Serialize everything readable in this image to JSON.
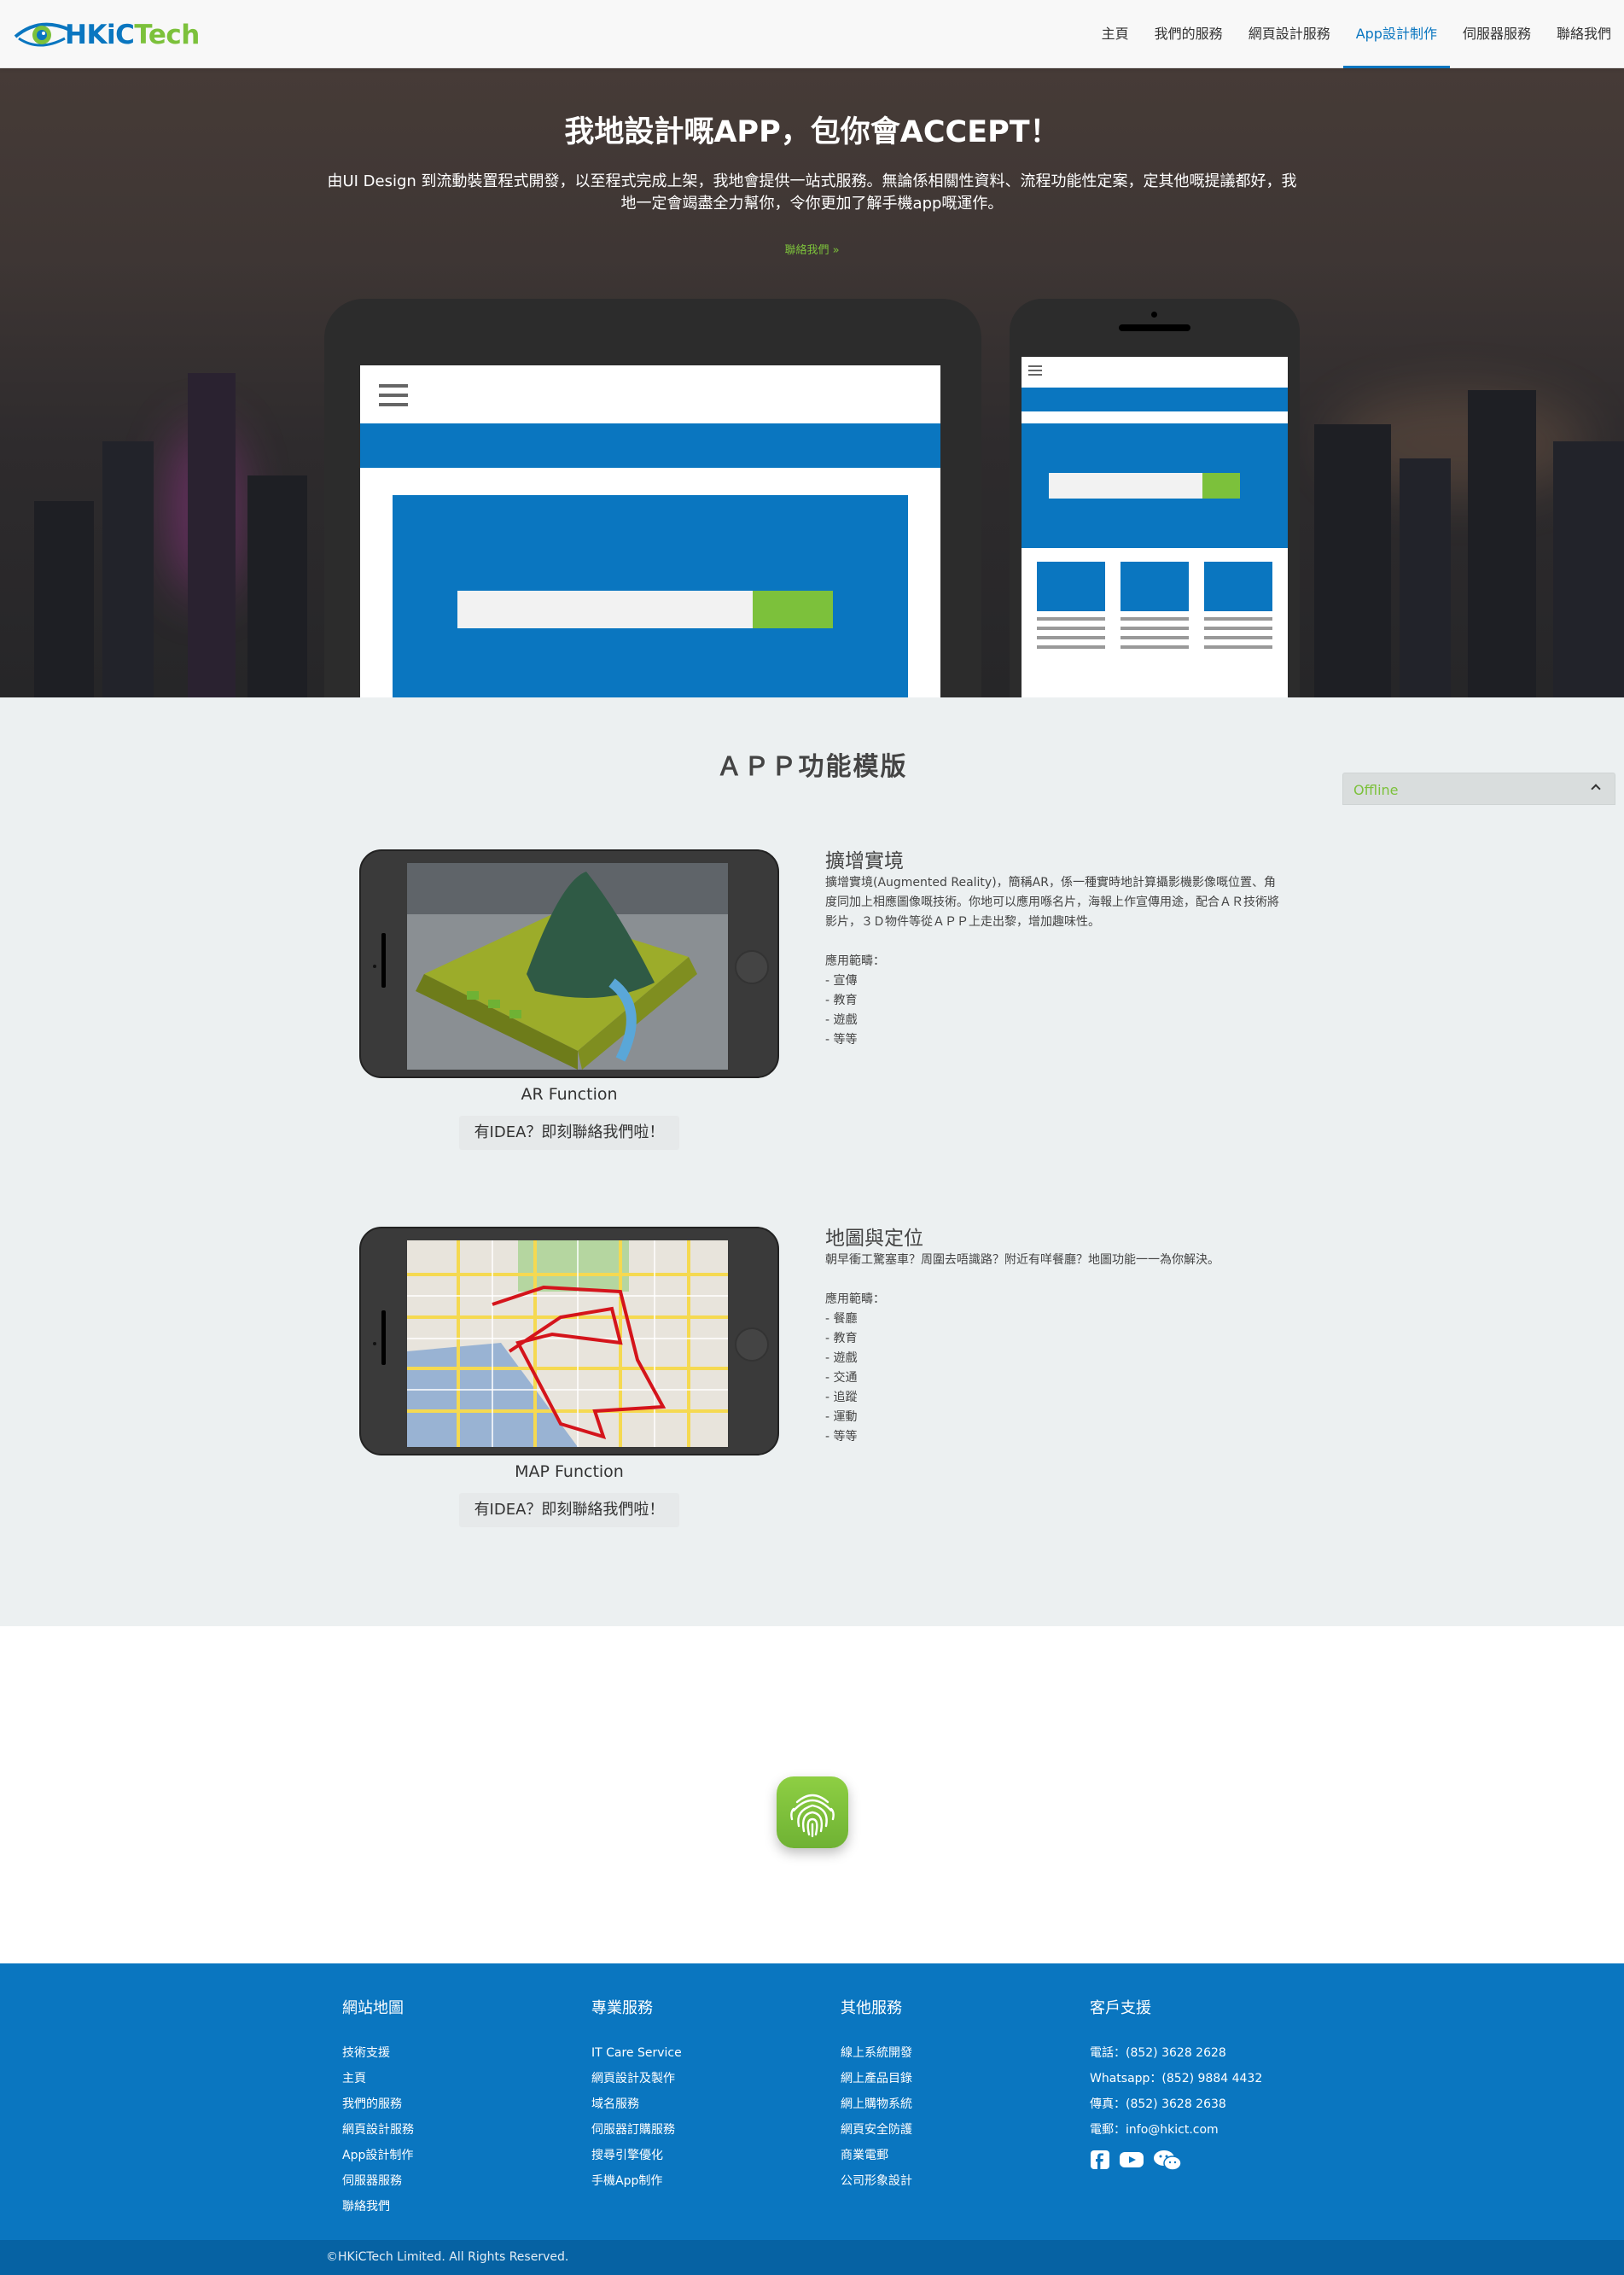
{
  "header": {
    "logo": {
      "brand_main": "HKiC",
      "brand_accent": "Tech",
      "icon": "eye-logo-icon"
    },
    "nav": [
      {
        "label": "主頁",
        "active": false
      },
      {
        "label": "我們的服務",
        "active": false
      },
      {
        "label": "網頁設計服務",
        "active": false
      },
      {
        "label": "App設計制作",
        "active": true
      },
      {
        "label": "伺服器服務",
        "active": false
      },
      {
        "label": "聯絡我們",
        "active": false
      }
    ]
  },
  "hero": {
    "title": "我地設計嘅APP，包你會ACCEPT！",
    "description": "由UI Design 到流動裝置程式開發，以至程式完成上架，我地會提供一站式服務。無論係相關性資料、流程功能性定案，定其他嘅提議都好，我地一定會竭盡全力幫你，令你更加了解手機app嘅運作。",
    "link": "聯絡我們 »"
  },
  "features": {
    "title": "ＡＰＰ功能模版",
    "chat": {
      "status": "Offline",
      "icon": "chevron-up-icon"
    },
    "items": [
      {
        "caption": "AR Function",
        "cta": "有IDEA？即刻聯絡我們啦！",
        "title": "擴增實境",
        "body": "擴增實境(Augmented Reality)，簡稱AR，係一種實時地計算攝影機影像嘅位置、角度同加上相應圖像嘅技術。你地可以應用喺名片，海報上作宣傳用途，配合ＡＲ技術將影片，３Ｄ物件等從ＡＰＰ上走出黎，增加趣味性。\n\n應用範疇：\n- 宣傳\n- 教育\n- 遊戲\n- 等等"
      },
      {
        "caption": "MAP Function",
        "cta": "有IDEA？即刻聯絡我們啦！",
        "title": "地圖與定位",
        "body": "朝早衝工驚塞車？周圍去唔識路？附近有咩餐廳？地圖功能一一為你解決。\n\n應用範疇：\n- 餐廳\n- 教育\n- 遊戲\n- 交通\n- 追蹤\n- 運動\n- 等等"
      }
    ]
  },
  "fingerprint": {
    "icon": "fingerprint-icon"
  },
  "footer": {
    "columns": [
      {
        "title": "網站地圖",
        "items": [
          "技術支援",
          "主頁",
          "我們的服務",
          "網頁設計服務",
          "App設計制作",
          "伺服器服務",
          "聯絡我們"
        ]
      },
      {
        "title": "專業服務",
        "items": [
          "IT Care Service",
          "網頁設計及製作",
          "域名服務",
          "伺服器訂購服務",
          "搜尋引擎優化",
          "手機App制作"
        ]
      },
      {
        "title": "其他服務",
        "items": [
          "線上系統開發",
          "網上產品目錄",
          "網上購物系統",
          "網頁安全防護",
          "商業電郵",
          "公司形象設計"
        ]
      },
      {
        "title": "客戶支援",
        "items": [
          "電話：(852) 3628 2628",
          "Whatsapp：(852) 9884 4432",
          "傳真：(852) 3628 2638",
          "電郵：info@hkict.com"
        ]
      }
    ],
    "social": [
      "facebook-icon",
      "youtube-icon",
      "wechat-icon"
    ],
    "copyright": "©HKiCTech Limited. All Rights Reserved."
  },
  "colors": {
    "brand_blue": "#0a76c0",
    "brand_green": "#7cc13b",
    "footer_bottom": "#0662a3"
  }
}
